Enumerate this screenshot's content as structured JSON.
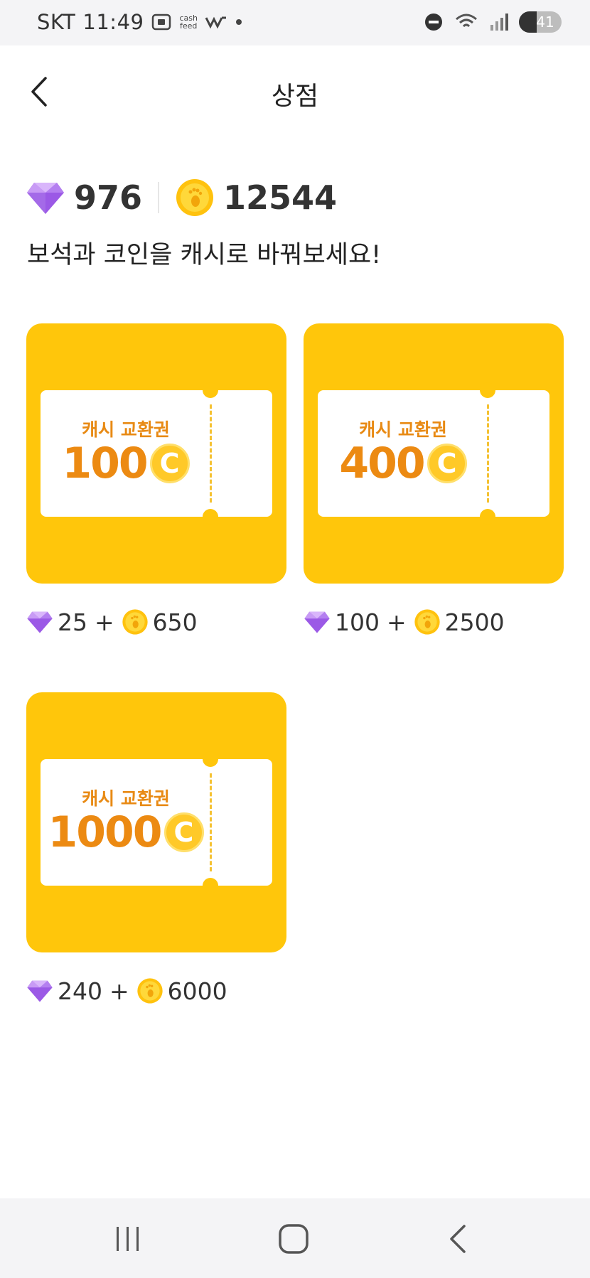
{
  "status_bar": {
    "carrier": "SKT",
    "time": "11:49",
    "cashfeed_line1": "cash",
    "cashfeed_line2": "feed",
    "battery": "41",
    "battery_level": 0.41
  },
  "header": {
    "title": "상점"
  },
  "balance": {
    "gems": "976",
    "coins": "12544"
  },
  "subtitle": "보석과 코인을 캐시로 바꿔보세요!",
  "items": [
    {
      "label": "캐시 교환권",
      "amount": "100",
      "coin_symbol": "C",
      "gems": "25",
      "plus": "+",
      "coins": "650"
    },
    {
      "label": "캐시 교환권",
      "amount": "400",
      "coin_symbol": "C",
      "gems": "100",
      "plus": "+",
      "coins": "2500"
    },
    {
      "label": "캐시 교환권",
      "amount": "1000",
      "coin_symbol": "C",
      "gems": "240",
      "plus": "+",
      "coins": "6000"
    }
  ],
  "colors": {
    "card_bg": "#ffc60b",
    "ticket_text": "#ec8a12",
    "gem": "#9b59e6",
    "coin": "#ffc20e"
  },
  "icons": {
    "back": "chevron-left-icon",
    "gem": "gem-icon",
    "coin": "footprint-coin-icon",
    "nav_recents": "recents-icon",
    "nav_home": "home-icon",
    "nav_back": "back-icon"
  }
}
